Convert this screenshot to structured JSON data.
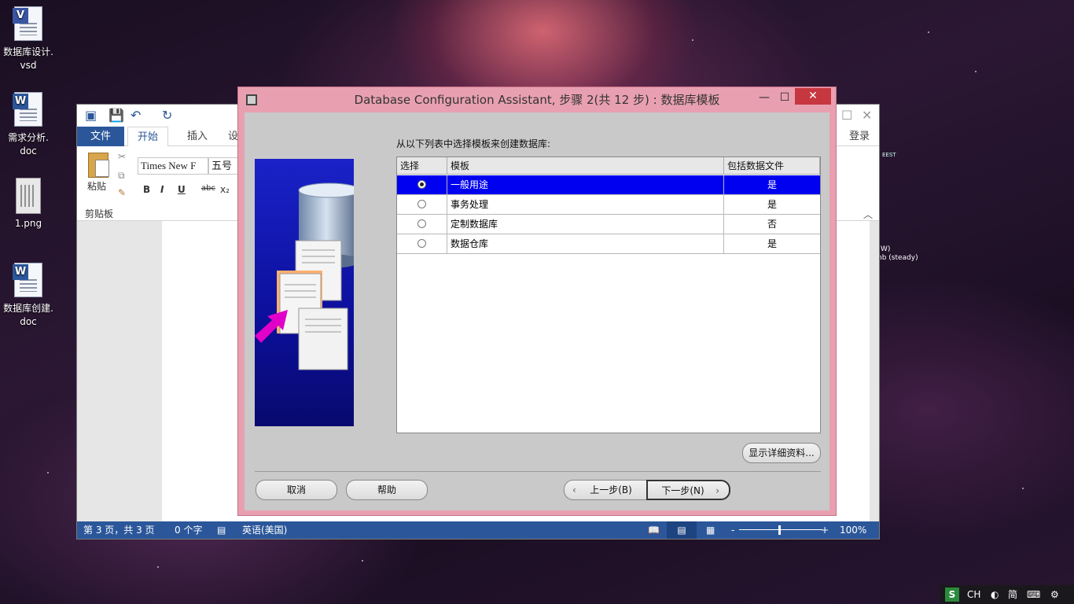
{
  "desktop": {
    "icons": [
      {
        "label": "数据库设计.\nvsd",
        "line1": "数据库设计.",
        "line2": "vsd"
      },
      {
        "label": "需求分析.\ndoc",
        "line1": "需求分析.",
        "line2": "doc"
      },
      {
        "label": "1.png",
        "line1": "1.png",
        "line2": ""
      },
      {
        "label": "数据库创建.\ndoc",
        "line1": "数据库创建.",
        "line2": "doc"
      }
    ],
    "side_text_1": "EEST",
    "side_text_2": "W)",
    "side_text_3": "nb (steady)"
  },
  "word": {
    "tabs": {
      "file": "文件",
      "home": "开始",
      "insert": "插入",
      "design": "设计"
    },
    "login": "登录",
    "ribbon": {
      "paste_label": "粘贴",
      "clipboard_label": "剪贴板",
      "font_name": "Times New F",
      "font_size": "五号",
      "bold": "B",
      "italic": "I",
      "underline": "U",
      "strike": "abc",
      "subscript": "x₂"
    },
    "statusbar": {
      "page": "第 3 页，共 3 页",
      "words": "0 个字",
      "language": "英语(美国)",
      "zoom": "100%",
      "zoom_minus": "-",
      "zoom_plus": "+"
    }
  },
  "dialog": {
    "title": "Database Configuration Assistant, 步骤 2(共 12 步) : 数据库模板",
    "controls": {
      "minimize": "—",
      "maximize": "☐",
      "close": "✕"
    },
    "instruction": "从以下列表中选择模板来创建数据库:",
    "table": {
      "headers": [
        "选择",
        "模板",
        "包括数据文件"
      ],
      "rows": [
        {
          "template": "一般用途",
          "includes": "是",
          "selected": true
        },
        {
          "template": "事务处理",
          "includes": "是",
          "selected": false
        },
        {
          "template": "定制数据库",
          "includes": "否",
          "selected": false
        },
        {
          "template": "数据仓库",
          "includes": "是",
          "selected": false
        }
      ]
    },
    "buttons": {
      "details": "显示详细资料...",
      "cancel": "取消",
      "help": "帮助",
      "back": "上一步(B)",
      "next": "下一步(N)"
    }
  },
  "tray": {
    "input_method": "S",
    "lang": "CH",
    "mode": "简"
  },
  "colors": {
    "dialog_frame": "#e8a0b0",
    "close_button": "#c7373f",
    "selected_row": "#0000f0",
    "word_blue": "#2b579a",
    "side_image": "#1a22c8"
  }
}
